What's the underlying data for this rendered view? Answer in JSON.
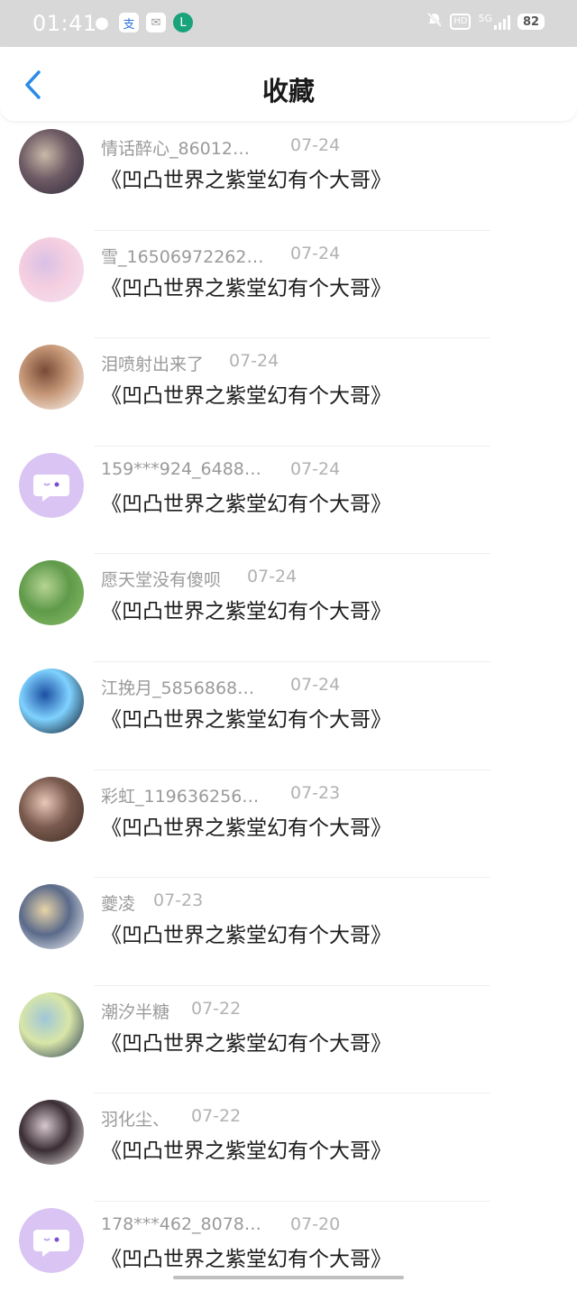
{
  "status": {
    "time": "01:41",
    "battery": "82",
    "network": "5G",
    "hd": "HD"
  },
  "header": {
    "title": "收藏"
  },
  "items": [
    {
      "user": "情话醉心_86012…",
      "date": "07-24",
      "title": "《凹凸世界之紫堂幻有个大哥》",
      "avatar_colors": [
        "#2b2a3a",
        "#c8b9a9",
        "#6e5a64"
      ]
    },
    {
      "user": "雪_16506972262…",
      "date": "07-24",
      "title": "《凹凸世界之紫堂幻有个大哥》",
      "avatar_colors": [
        "#f3e4f4",
        "#d9c0e6",
        "#f5cfe0"
      ]
    },
    {
      "user": "泪喷射出来了",
      "date": "07-24",
      "title": "《凹凸世界之紫堂幻有个大哥》",
      "avatar_colors": [
        "#ffffff",
        "#7a4a36",
        "#c89a7a"
      ]
    },
    {
      "user": "159***924_6488…",
      "date": "07-24",
      "title": "《凹凸世界之紫堂幻有个大哥》",
      "avatar_colors": [
        "#d9c4f3",
        "#d9c4f3",
        "#ffffff"
      ]
    },
    {
      "user": "愿天堂没有傻呗",
      "date": "07-24",
      "title": "《凹凸世界之紫堂幻有个大哥》",
      "avatar_colors": [
        "#8cbf6a",
        "#b6d494",
        "#5f9a4a"
      ]
    },
    {
      "user": "江挽月_5856868…",
      "date": "07-24",
      "title": "《凹凸世界之紫堂幻有个大哥》",
      "avatar_colors": [
        "#050a18",
        "#1d4fa3",
        "#7fd2ff"
      ]
    },
    {
      "user": "彩虹_119636256…",
      "date": "07-23",
      "title": "《凹凸世界之紫堂幻有个大哥》",
      "avatar_colors": [
        "#3a2a24",
        "#e9c8b8",
        "#7a5a4e"
      ]
    },
    {
      "user": "夔凌",
      "date": "07-23",
      "title": "《凹凸世界之紫堂幻有个大哥》",
      "avatar_colors": [
        "#ffffff",
        "#e8d4a8",
        "#5a6a8a"
      ]
    },
    {
      "user": "潮汐半糖",
      "date": "07-22",
      "title": "《凹凸世界之紫堂幻有个大哥》",
      "avatar_colors": [
        "#1e3550",
        "#9fc6d8",
        "#d9e6a8"
      ]
    },
    {
      "user": "羽化尘、",
      "date": "07-22",
      "title": "《凹凸世界之紫堂幻有个大哥》",
      "avatar_colors": [
        "#f3f0f0",
        "#d8c8d0",
        "#3a2e34"
      ]
    },
    {
      "user": "178***462_8078…",
      "date": "07-20",
      "title": "《凹凸世界之紫堂幻有个大哥》",
      "avatar_colors": [
        "#d9c4f3",
        "#d9c4f3",
        "#ffffff"
      ]
    }
  ]
}
